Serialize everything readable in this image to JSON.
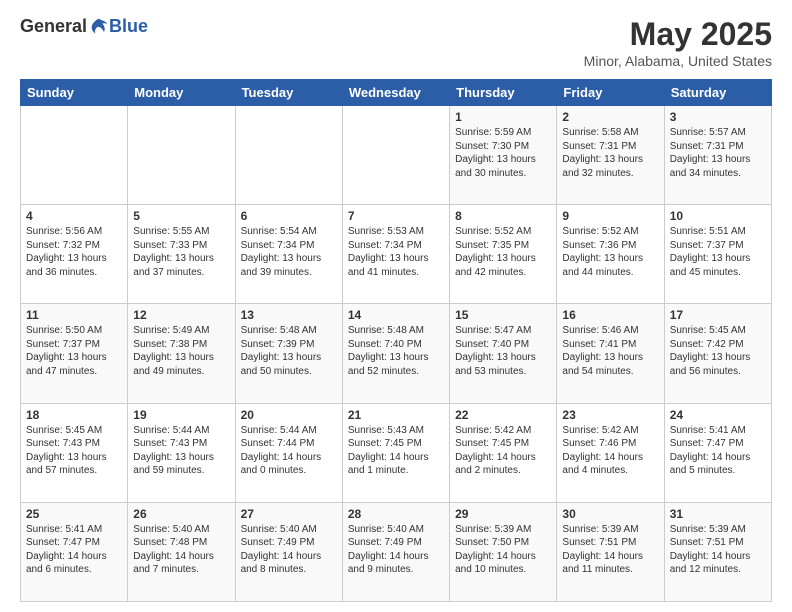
{
  "header": {
    "logo_general": "General",
    "logo_blue": "Blue",
    "title": "May 2025",
    "subtitle": "Minor, Alabama, United States"
  },
  "calendar": {
    "days_of_week": [
      "Sunday",
      "Monday",
      "Tuesday",
      "Wednesday",
      "Thursday",
      "Friday",
      "Saturday"
    ],
    "weeks": [
      [
        {
          "day": "",
          "info": ""
        },
        {
          "day": "",
          "info": ""
        },
        {
          "day": "",
          "info": ""
        },
        {
          "day": "",
          "info": ""
        },
        {
          "day": "1",
          "info": "Sunrise: 5:59 AM\nSunset: 7:30 PM\nDaylight: 13 hours\nand 30 minutes."
        },
        {
          "day": "2",
          "info": "Sunrise: 5:58 AM\nSunset: 7:31 PM\nDaylight: 13 hours\nand 32 minutes."
        },
        {
          "day": "3",
          "info": "Sunrise: 5:57 AM\nSunset: 7:31 PM\nDaylight: 13 hours\nand 34 minutes."
        }
      ],
      [
        {
          "day": "4",
          "info": "Sunrise: 5:56 AM\nSunset: 7:32 PM\nDaylight: 13 hours\nand 36 minutes."
        },
        {
          "day": "5",
          "info": "Sunrise: 5:55 AM\nSunset: 7:33 PM\nDaylight: 13 hours\nand 37 minutes."
        },
        {
          "day": "6",
          "info": "Sunrise: 5:54 AM\nSunset: 7:34 PM\nDaylight: 13 hours\nand 39 minutes."
        },
        {
          "day": "7",
          "info": "Sunrise: 5:53 AM\nSunset: 7:34 PM\nDaylight: 13 hours\nand 41 minutes."
        },
        {
          "day": "8",
          "info": "Sunrise: 5:52 AM\nSunset: 7:35 PM\nDaylight: 13 hours\nand 42 minutes."
        },
        {
          "day": "9",
          "info": "Sunrise: 5:52 AM\nSunset: 7:36 PM\nDaylight: 13 hours\nand 44 minutes."
        },
        {
          "day": "10",
          "info": "Sunrise: 5:51 AM\nSunset: 7:37 PM\nDaylight: 13 hours\nand 45 minutes."
        }
      ],
      [
        {
          "day": "11",
          "info": "Sunrise: 5:50 AM\nSunset: 7:37 PM\nDaylight: 13 hours\nand 47 minutes."
        },
        {
          "day": "12",
          "info": "Sunrise: 5:49 AM\nSunset: 7:38 PM\nDaylight: 13 hours\nand 49 minutes."
        },
        {
          "day": "13",
          "info": "Sunrise: 5:48 AM\nSunset: 7:39 PM\nDaylight: 13 hours\nand 50 minutes."
        },
        {
          "day": "14",
          "info": "Sunrise: 5:48 AM\nSunset: 7:40 PM\nDaylight: 13 hours\nand 52 minutes."
        },
        {
          "day": "15",
          "info": "Sunrise: 5:47 AM\nSunset: 7:40 PM\nDaylight: 13 hours\nand 53 minutes."
        },
        {
          "day": "16",
          "info": "Sunrise: 5:46 AM\nSunset: 7:41 PM\nDaylight: 13 hours\nand 54 minutes."
        },
        {
          "day": "17",
          "info": "Sunrise: 5:45 AM\nSunset: 7:42 PM\nDaylight: 13 hours\nand 56 minutes."
        }
      ],
      [
        {
          "day": "18",
          "info": "Sunrise: 5:45 AM\nSunset: 7:43 PM\nDaylight: 13 hours\nand 57 minutes."
        },
        {
          "day": "19",
          "info": "Sunrise: 5:44 AM\nSunset: 7:43 PM\nDaylight: 13 hours\nand 59 minutes."
        },
        {
          "day": "20",
          "info": "Sunrise: 5:44 AM\nSunset: 7:44 PM\nDaylight: 14 hours\nand 0 minutes."
        },
        {
          "day": "21",
          "info": "Sunrise: 5:43 AM\nSunset: 7:45 PM\nDaylight: 14 hours\nand 1 minute."
        },
        {
          "day": "22",
          "info": "Sunrise: 5:42 AM\nSunset: 7:45 PM\nDaylight: 14 hours\nand 2 minutes."
        },
        {
          "day": "23",
          "info": "Sunrise: 5:42 AM\nSunset: 7:46 PM\nDaylight: 14 hours\nand 4 minutes."
        },
        {
          "day": "24",
          "info": "Sunrise: 5:41 AM\nSunset: 7:47 PM\nDaylight: 14 hours\nand 5 minutes."
        }
      ],
      [
        {
          "day": "25",
          "info": "Sunrise: 5:41 AM\nSunset: 7:47 PM\nDaylight: 14 hours\nand 6 minutes."
        },
        {
          "day": "26",
          "info": "Sunrise: 5:40 AM\nSunset: 7:48 PM\nDaylight: 14 hours\nand 7 minutes."
        },
        {
          "day": "27",
          "info": "Sunrise: 5:40 AM\nSunset: 7:49 PM\nDaylight: 14 hours\nand 8 minutes."
        },
        {
          "day": "28",
          "info": "Sunrise: 5:40 AM\nSunset: 7:49 PM\nDaylight: 14 hours\nand 9 minutes."
        },
        {
          "day": "29",
          "info": "Sunrise: 5:39 AM\nSunset: 7:50 PM\nDaylight: 14 hours\nand 10 minutes."
        },
        {
          "day": "30",
          "info": "Sunrise: 5:39 AM\nSunset: 7:51 PM\nDaylight: 14 hours\nand 11 minutes."
        },
        {
          "day": "31",
          "info": "Sunrise: 5:39 AM\nSunset: 7:51 PM\nDaylight: 14 hours\nand 12 minutes."
        }
      ]
    ]
  }
}
